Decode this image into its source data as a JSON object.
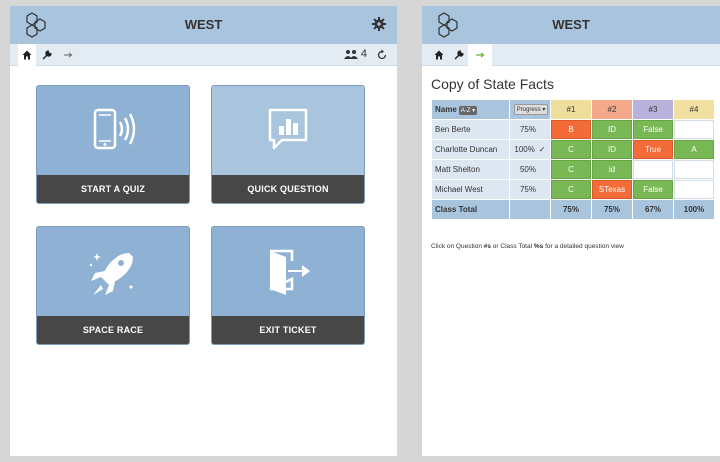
{
  "left": {
    "title": "WEST",
    "student_count": "4",
    "tiles": [
      {
        "label": "START A QUIZ"
      },
      {
        "label": "QUICK QUESTION"
      },
      {
        "label": "SPACE RACE"
      },
      {
        "label": "EXIT TICKET"
      }
    ]
  },
  "right": {
    "title": "WEST",
    "report_title": "Copy of State Facts",
    "name_header": "Name",
    "sort_label": "A-Z",
    "progress_label": "Progress",
    "questions": [
      "#1",
      "#2",
      "#3",
      "#4"
    ],
    "question_colors": [
      "#f0de9c",
      "#f4a98c",
      "#b9b2dd",
      "#f2e0a2"
    ],
    "rows": [
      {
        "name": "Ben Berte",
        "progress": "75%",
        "check": "",
        "answers": [
          "B",
          "ID",
          "False",
          ""
        ],
        "colors": [
          "orange",
          "green",
          "green",
          "empty"
        ]
      },
      {
        "name": "Charlotte Duncan",
        "progress": "100%",
        "check": "✓",
        "answers": [
          "C",
          "ID",
          "True",
          "A"
        ],
        "colors": [
          "green",
          "green",
          "orange",
          "green"
        ]
      },
      {
        "name": "Matt Shelton",
        "progress": "50%",
        "check": "",
        "answers": [
          "C",
          "id",
          "",
          ""
        ],
        "colors": [
          "green",
          "green",
          "empty",
          "empty"
        ]
      },
      {
        "name": "Michael West",
        "progress": "75%",
        "check": "",
        "answers": [
          "C",
          "STexas",
          "False",
          ""
        ],
        "colors": [
          "green",
          "orange",
          "green",
          "empty"
        ]
      }
    ],
    "total_label": "Class Total",
    "totals": [
      "75%",
      "75%",
      "67%",
      "100%"
    ],
    "hint_prefix": "Click on Question ",
    "hint_b1": "#s",
    "hint_mid": " or Class Total ",
    "hint_b2": "%s",
    "hint_suffix": " for a detailed question view"
  },
  "colors": {
    "header": "#a9c5de",
    "tile": "#8fb2d4",
    "tile_label_bg": "#474747",
    "orange": "#f26b38",
    "green": "#79b955"
  }
}
